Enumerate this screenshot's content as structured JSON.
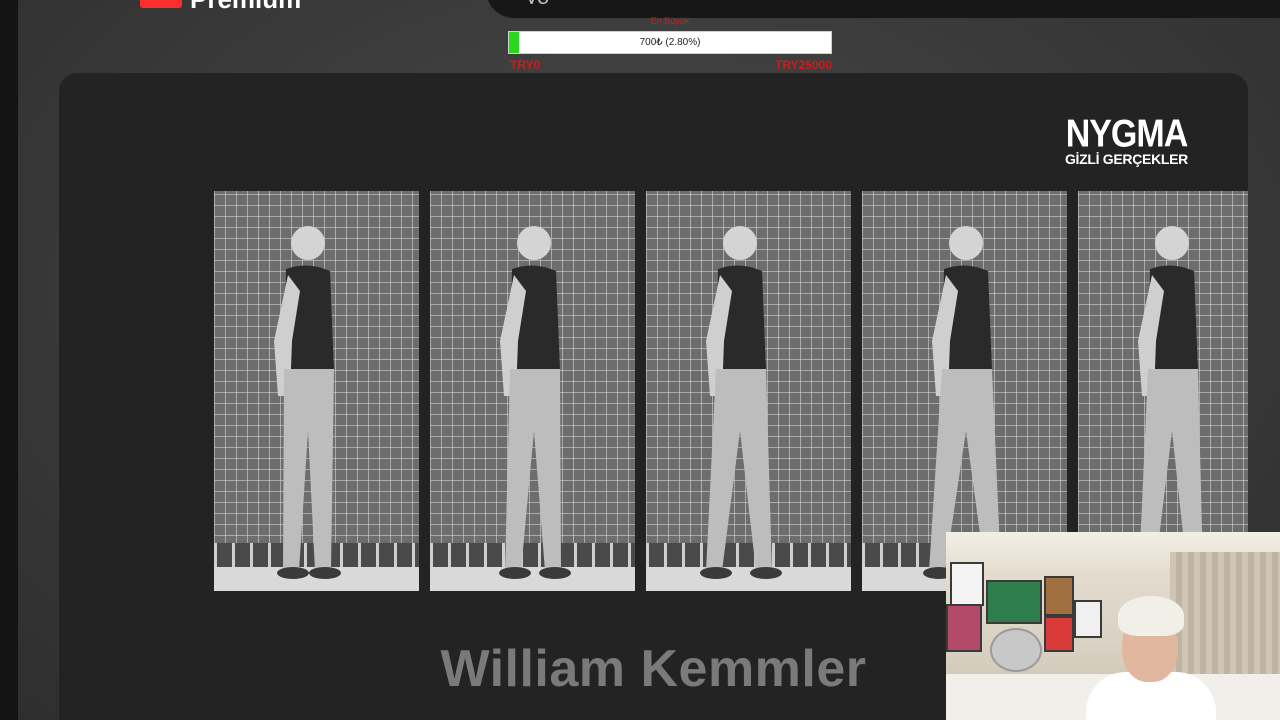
{
  "brand": {
    "logo_text": "Premium"
  },
  "top_bar": {
    "search_text": "yo"
  },
  "donation_goal": {
    "title": "En Büyük",
    "progress_text": "700₺ (2.80%)",
    "progress_fraction": 0.028,
    "min_label": "TRY0",
    "max_label": "TRY25000",
    "fill_color": "#27d81f",
    "label_color": "#d11a1a"
  },
  "video": {
    "watermark_main": "NYGMA",
    "watermark_sub": "GİZLİ GERÇEKLER",
    "caption": "William Kemmler",
    "frames": [
      {
        "name": "walking-frame-1"
      },
      {
        "name": "walking-frame-2"
      },
      {
        "name": "walking-frame-3"
      },
      {
        "name": "walking-frame-4"
      },
      {
        "name": "walking-frame-5"
      }
    ]
  }
}
